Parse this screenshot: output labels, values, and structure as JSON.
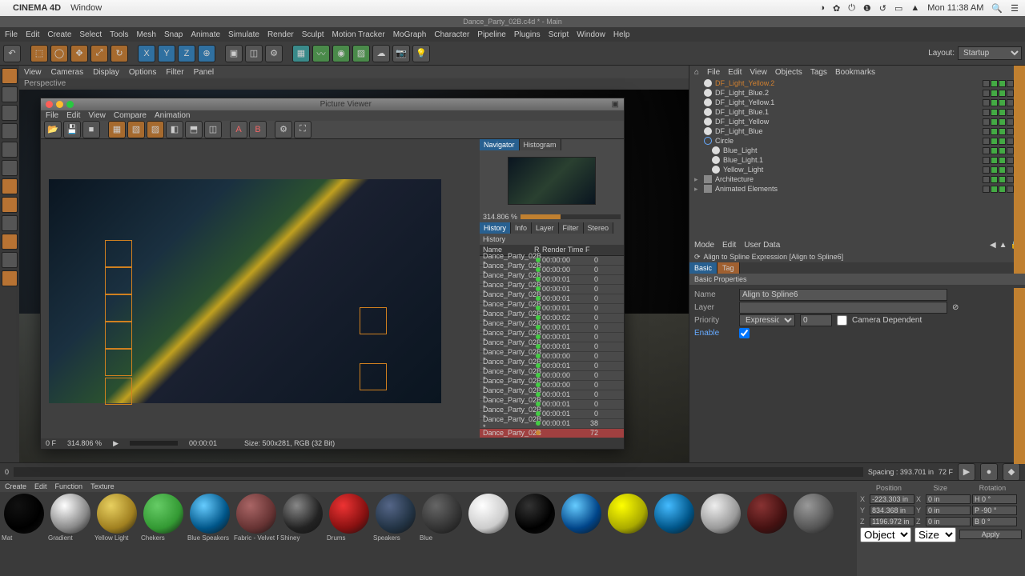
{
  "mac": {
    "app": "CINEMA 4D",
    "menus": [
      "Window"
    ],
    "time": "Mon 11:38 AM"
  },
  "window_title": "Dance_Party_02B.c4d * - Main",
  "main_menu": [
    "File",
    "Edit",
    "Create",
    "Select",
    "Tools",
    "Mesh",
    "Snap",
    "Animate",
    "Simulate",
    "Render",
    "Sculpt",
    "Motion Tracker",
    "MoGraph",
    "Character",
    "Pipeline",
    "Plugins",
    "Script",
    "Window",
    "Help"
  ],
  "layout_label": "Layout:",
  "layout_value": "Startup",
  "view_menu": [
    "View",
    "Cameras",
    "Display",
    "Options",
    "Filter",
    "Panel"
  ],
  "view_name": "Perspective",
  "picture_viewer": {
    "title": "Picture Viewer",
    "menu": [
      "File",
      "Edit",
      "View",
      "Compare",
      "Animation"
    ],
    "nav_tabs": [
      "Navigator",
      "Histogram"
    ],
    "zoom": "314.806 %",
    "tabs": [
      "History",
      "Info",
      "Layer",
      "Filter",
      "Stereo"
    ],
    "history_label": "History",
    "columns": {
      "name": "Name",
      "r": "R",
      "rt": "Render Time",
      "f": "F"
    },
    "rows": [
      {
        "name": "Dance_Party_02B *",
        "rt": "00:00:00",
        "f": "0"
      },
      {
        "name": "Dance_Party_02B *",
        "rt": "00:00:00",
        "f": "0"
      },
      {
        "name": "Dance_Party_02B *",
        "rt": "00:00:01",
        "f": "0"
      },
      {
        "name": "Dance_Party_02B *",
        "rt": "00:00:01",
        "f": "0"
      },
      {
        "name": "Dance_Party_02B *",
        "rt": "00:00:01",
        "f": "0"
      },
      {
        "name": "Dance_Party_02B *",
        "rt": "00:00:01",
        "f": "0"
      },
      {
        "name": "Dance_Party_02B *",
        "rt": "00:00:02",
        "f": "0"
      },
      {
        "name": "Dance_Party_02B *",
        "rt": "00:00:01",
        "f": "0"
      },
      {
        "name": "Dance_Party_02B *",
        "rt": "00:00:01",
        "f": "0"
      },
      {
        "name": "Dance_Party_02B *",
        "rt": "00:00:01",
        "f": "0"
      },
      {
        "name": "Dance_Party_02B *",
        "rt": "00:00:00",
        "f": "0"
      },
      {
        "name": "Dance_Party_02B *",
        "rt": "00:00:01",
        "f": "0"
      },
      {
        "name": "Dance_Party_02B *",
        "rt": "00:00:00",
        "f": "0"
      },
      {
        "name": "Dance_Party_02B *",
        "rt": "00:00:00",
        "f": "0"
      },
      {
        "name": "Dance_Party_02B *",
        "rt": "00:00:01",
        "f": "0"
      },
      {
        "name": "Dance_Party_02B *",
        "rt": "00:00:01",
        "f": "0"
      },
      {
        "name": "Dance_Party_02B *",
        "rt": "00:00:01",
        "f": "0"
      },
      {
        "name": "Dance_Party_02B *",
        "rt": "00:00:01",
        "f": "38"
      },
      {
        "name": "Dance_Party_02B",
        "rt": "",
        "f": "72",
        "sel": true
      }
    ],
    "status_frame": "0 F",
    "status_zoom": "314.806 %",
    "status_time": "00:00:01",
    "status_size": "Size: 500x281, RGB (32 Bit)"
  },
  "obj_menu": [
    "File",
    "Edit",
    "View",
    "Objects",
    "Tags",
    "Bookmarks"
  ],
  "objects": [
    {
      "name": "DF_Light_Yellow.2",
      "sel": true,
      "icon": "light"
    },
    {
      "name": "DF_Light_Blue.2",
      "icon": "light"
    },
    {
      "name": "DF_Light_Yellow.1",
      "icon": "light"
    },
    {
      "name": "DF_Light_Blue.1",
      "icon": "light"
    },
    {
      "name": "DF_Light_Yellow",
      "icon": "light"
    },
    {
      "name": "DF_Light_Blue",
      "icon": "light"
    },
    {
      "name": "Circle",
      "icon": "circle"
    },
    {
      "name": "Blue_Light",
      "icon": "light",
      "indent": 1
    },
    {
      "name": "Blue_Light.1",
      "icon": "light",
      "indent": 1
    },
    {
      "name": "Yellow_Light",
      "icon": "light",
      "indent": 1
    },
    {
      "name": "Architecture",
      "icon": "null",
      "indent": 0,
      "tri": true
    },
    {
      "name": "Animated Elements",
      "icon": "null",
      "indent": 0,
      "tri": true
    }
  ],
  "attr_menu": [
    "Mode",
    "Edit",
    "User Data"
  ],
  "attr_title": "Align to Spline Expression [Align to Spline6]",
  "attr_tabs": [
    "Basic",
    "Tag"
  ],
  "attr_section": "Basic Properties",
  "attr": {
    "name_label": "Name",
    "name_value": "Align to Spline6",
    "layer_label": "Layer",
    "priority_label": "Priority",
    "priority_value": "Expression",
    "priority_num": "0",
    "camdep_label": "Camera Dependent",
    "enable_label": "Enable"
  },
  "status_hint": "Spacing : 393.701 in",
  "timeline_frame": "72 F",
  "mat_menu": [
    "Create",
    "Edit",
    "Function",
    "Texture"
  ],
  "materials": [
    {
      "label": "Mat",
      "c1": "#111",
      "c2": "#000"
    },
    {
      "label": "Gradient",
      "c1": "#fff",
      "c2": "#888"
    },
    {
      "label": "Yellow Light",
      "c1": "#e8d060",
      "c2": "#a08020"
    },
    {
      "label": "Chekers",
      "c1": "#6c6",
      "c2": "#393"
    },
    {
      "label": "Blue Speakers",
      "c1": "#6cf",
      "c2": "#058"
    },
    {
      "label": "Fabric - Velvet Re",
      "c1": "#a66",
      "c2": "#633"
    },
    {
      "label": "Shiney",
      "c1": "#888",
      "c2": "#222"
    },
    {
      "label": "Drums",
      "c1": "#e33",
      "c2": "#811"
    },
    {
      "label": "Speakers",
      "c1": "#568",
      "c2": "#234"
    },
    {
      "label": "Blue",
      "c1": "#666",
      "c2": "#333"
    },
    {
      "label": "",
      "c1": "#fff",
      "c2": "#ccc"
    },
    {
      "label": "",
      "c1": "#333",
      "c2": "#000"
    },
    {
      "label": "",
      "c1": "#6cf",
      "c2": "#048"
    },
    {
      "label": "",
      "c1": "#ff0",
      "c2": "#aa0"
    },
    {
      "label": "",
      "c1": "#4bf",
      "c2": "#058"
    },
    {
      "label": "",
      "c1": "#eee",
      "c2": "#999"
    },
    {
      "label": "",
      "c1": "#833",
      "c2": "#411"
    },
    {
      "label": "",
      "c1": "#999",
      "c2": "#555"
    }
  ],
  "coords": {
    "headers": [
      "Position",
      "Size",
      "Rotation"
    ],
    "rows": [
      {
        "axis": "X",
        "p": "-223.303 in",
        "s": "0 in",
        "r": "H 0 °"
      },
      {
        "axis": "Y",
        "p": "834.368 in",
        "s": "0 in",
        "r": "P -90 °"
      },
      {
        "axis": "Z",
        "p": "1196.972 in",
        "s": "0 in",
        "r": "B 0 °"
      }
    ],
    "mode1": "Object (Rel)",
    "mode2": "Size",
    "apply": "Apply"
  }
}
